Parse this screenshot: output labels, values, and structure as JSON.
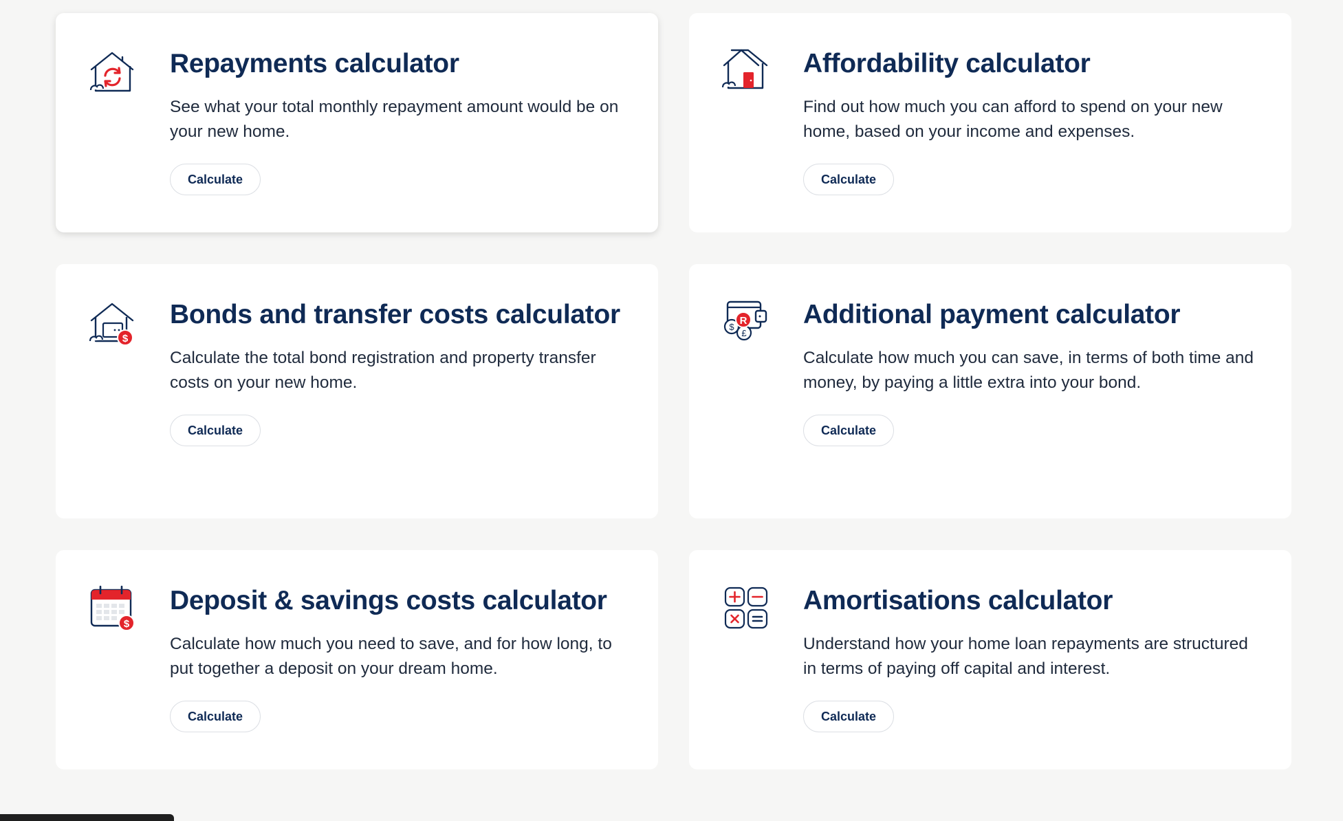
{
  "colors": {
    "accent_red": "#e3242b",
    "navy": "#0f2a55",
    "background": "#f6f6f5"
  },
  "cards": [
    {
      "title": "Repayments calculator",
      "description": "See what your total monthly repayment amount would be on your new home.",
      "button": "Calculate",
      "icon": "house-refresh-icon"
    },
    {
      "title": "Affordability calculator",
      "description": "Find out how much you can afford to spend on your new home, based on your income and expenses.",
      "button": "Calculate",
      "icon": "house-door-icon"
    },
    {
      "title": "Bonds and transfer costs calculator",
      "description": "Calculate the total bond registration and property transfer costs on your new home.",
      "button": "Calculate",
      "icon": "house-dollar-icon"
    },
    {
      "title": "Additional payment calculator",
      "description": "Calculate how much you can save, in terms of both time and money, by paying a little extra into your bond.",
      "button": "Calculate",
      "icon": "wallet-coins-icon",
      "icon_text": {
        "rand": "R",
        "dollar": "$",
        "pound": "£"
      }
    },
    {
      "title": "Deposit & savings costs calculator",
      "description": "Calculate how much you need to save, and for how long, to put together a deposit on your dream home.",
      "button": "Calculate",
      "icon": "calendar-dollar-icon"
    },
    {
      "title": "Amortisations calculator",
      "description": "Understand how your home loan repayments are structured in terms of paying off capital and interest.",
      "button": "Calculate",
      "icon": "calculator-operators-icon"
    }
  ]
}
